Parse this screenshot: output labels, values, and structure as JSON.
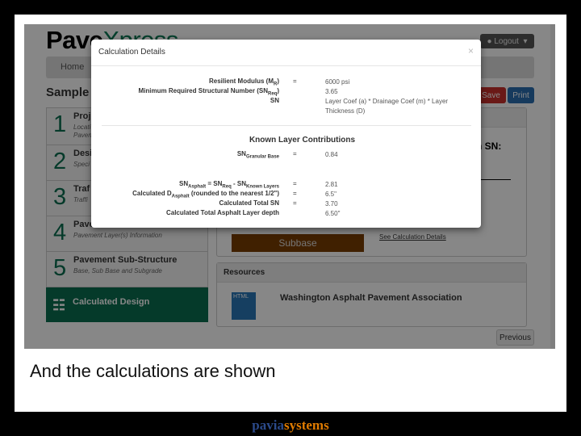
{
  "app": {
    "logo_a": "Pave",
    "logo_b": "Xpress",
    "logout": "Logout",
    "nav_home": "Home",
    "page_title": "Sample",
    "save": "Save",
    "print": "Print",
    "previous": "Previous"
  },
  "steps": [
    {
      "num": "1",
      "title": "Proj",
      "sub": "Locati",
      "sub2": "Paven"
    },
    {
      "num": "2",
      "title": "Desi",
      "sub": "Speci"
    },
    {
      "num": "3",
      "title": "Traf",
      "sub": "Traffi"
    },
    {
      "num": "4",
      "title": "Pave",
      "sub": "Pavement Layer(s) Information"
    },
    {
      "num": "5",
      "title": "Pavement Sub-Structure",
      "sub": "Base, Sub Base and Subgrade"
    }
  ],
  "calculated_design": "Calculated Design",
  "design_panel": {
    "sn_label": "n SN:",
    "subbase": "Subbase",
    "link": "See Calculation Details"
  },
  "resources": {
    "header": "Resources",
    "icon_label": "HTML",
    "item": "Washington Asphalt Pavement Association"
  },
  "modal": {
    "title": "Calculation Details",
    "close": "×",
    "rows": [
      {
        "label": "Resilient Modulus (M",
        "sub": "R",
        "tail": ")",
        "eq": "=",
        "value": "6000 psi"
      },
      {
        "label": "Minimum Required Structural Number (SN",
        "sub": "Req",
        "tail": ")",
        "eq": "",
        "value": "3.65"
      },
      {
        "label": "SN",
        "sub": "",
        "tail": "",
        "eq": "",
        "value": "Layer Coef (a) * Drainage Coef (m) * Layer Thickness (D)"
      }
    ],
    "section_title": "Known Layer Contributions",
    "known": [
      {
        "label": "SN",
        "sub": "Granular Base",
        "eq": "=",
        "value": "0.84"
      }
    ],
    "results": [
      {
        "label": "SN",
        "sub": "Asphalt",
        "tail": " = SN",
        "sub2": "Req",
        "tail2": " - SN",
        "sub3": "Known Layers",
        "eq": "=",
        "value": "2.81"
      },
      {
        "label": "Calculated D",
        "sub": "Asphalt",
        "tail": " (rounded to the nearest 1/2\")",
        "eq": "=",
        "value": "6.5\""
      },
      {
        "label": "Calculated Total SN",
        "eq": "=",
        "value": "3.70"
      },
      {
        "label": "Calculated Total Asphalt Layer depth",
        "eq": "",
        "value": "6.50\""
      }
    ]
  },
  "caption": "And the calculations are shown",
  "footer": {
    "a": "pavia",
    "b": "systems"
  },
  "colors": {
    "brand_green": "#0a6e50",
    "save": "#c9302c",
    "print": "#2a6fb0",
    "subbase": "#7a3e00",
    "footer_a": "#2b4a8a",
    "footer_b": "#e07b00"
  }
}
